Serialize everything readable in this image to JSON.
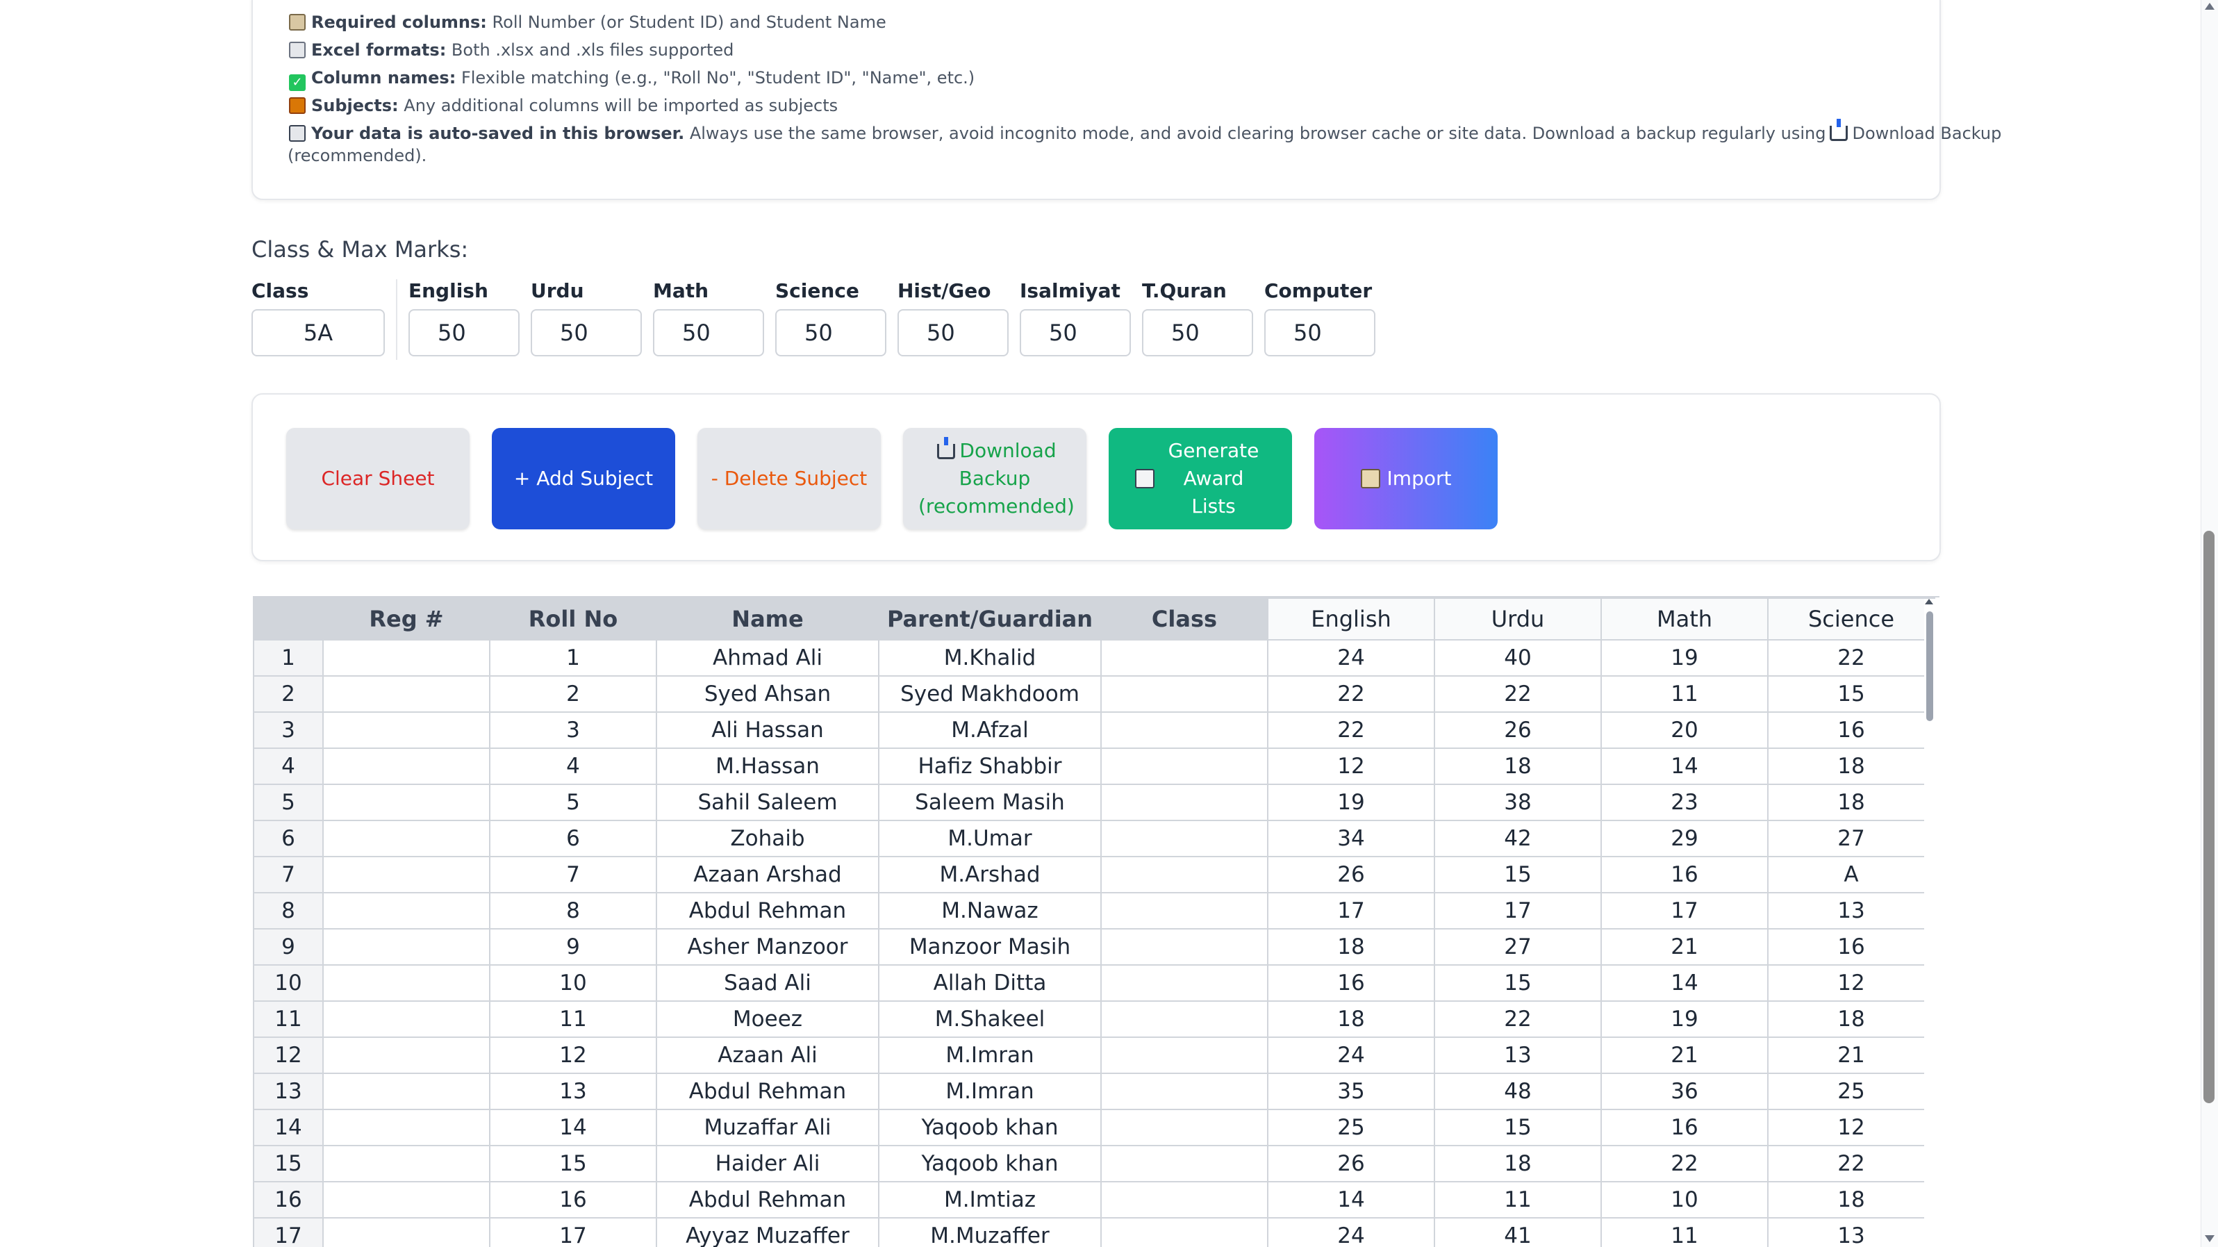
{
  "info": {
    "required_bold": "Required columns:",
    "required_text": " Roll Number (or Student ID) and Student Name",
    "excel_bold": "Excel formats:",
    "excel_text": " Both .xlsx and .xls files supported",
    "colnames_bold": "Column names:",
    "colnames_text": " Flexible matching (e.g., \"Roll No\", \"Student ID\", \"Name\", etc.)",
    "subjects_bold": "Subjects:",
    "subjects_text": " Any additional columns will be imported as subjects",
    "autosave_bold": "Your data is auto-saved in this browser.",
    "autosave_text": " Always use the same browser, avoid incognito mode, and avoid clearing browser cache or site data. Download a backup regularly using",
    "autosave_link": "Download Backup",
    "autosave_tail": "(recommended)."
  },
  "marks": {
    "title": "Class & Max Marks:",
    "class_label": "Class",
    "class_value": "5A",
    "subjects": [
      {
        "label": "English",
        "value": "50"
      },
      {
        "label": "Urdu",
        "value": "50"
      },
      {
        "label": "Math",
        "value": "50"
      },
      {
        "label": "Science",
        "value": "50"
      },
      {
        "label": "Hist/Geo",
        "value": "50"
      },
      {
        "label": "Isalmiyat",
        "value": "50"
      },
      {
        "label": "T.Quran",
        "value": "50"
      },
      {
        "label": "Computer",
        "value": "50"
      }
    ]
  },
  "buttons": {
    "clear": "Clear Sheet",
    "add": "+ Add Subject",
    "delete": "- Delete Subject",
    "download": "Download Backup (recommended)",
    "generate": "Generate Award Lists",
    "import": "Import"
  },
  "table": {
    "headers": [
      "",
      "Reg #",
      "Roll No",
      "Name",
      "Parent/Guardian",
      "Class",
      "English",
      "Urdu",
      "Math",
      "Science"
    ],
    "rows": [
      [
        "1",
        "",
        "1",
        "Ahmad Ali",
        "M.Khalid",
        "",
        "24",
        "40",
        "19",
        "22"
      ],
      [
        "2",
        "",
        "2",
        "Syed Ahsan",
        "Syed Makhdoom",
        "",
        "22",
        "22",
        "11",
        "15"
      ],
      [
        "3",
        "",
        "3",
        "Ali Hassan",
        "M.Afzal",
        "",
        "22",
        "26",
        "20",
        "16"
      ],
      [
        "4",
        "",
        "4",
        "M.Hassan",
        "Hafiz Shabbir",
        "",
        "12",
        "18",
        "14",
        "18"
      ],
      [
        "5",
        "",
        "5",
        "Sahil Saleem",
        "Saleem Masih",
        "",
        "19",
        "38",
        "23",
        "18"
      ],
      [
        "6",
        "",
        "6",
        "Zohaib",
        "M.Umar",
        "",
        "34",
        "42",
        "29",
        "27"
      ],
      [
        "7",
        "",
        "7",
        "Azaan Arshad",
        "M.Arshad",
        "",
        "26",
        "15",
        "16",
        "A"
      ],
      [
        "8",
        "",
        "8",
        "Abdul Rehman",
        "M.Nawaz",
        "",
        "17",
        "17",
        "17",
        "13"
      ],
      [
        "9",
        "",
        "9",
        "Asher Manzoor",
        "Manzoor Masih",
        "",
        "18",
        "27",
        "21",
        "16"
      ],
      [
        "10",
        "",
        "10",
        "Saad Ali",
        "Allah Ditta",
        "",
        "16",
        "15",
        "14",
        "12"
      ],
      [
        "11",
        "",
        "11",
        "Moeez",
        "M.Shakeel",
        "",
        "18",
        "22",
        "19",
        "18"
      ],
      [
        "12",
        "",
        "12",
        "Azaan Ali",
        "M.Imran",
        "",
        "24",
        "13",
        "21",
        "21"
      ],
      [
        "13",
        "",
        "13",
        "Abdul Rehman",
        "M.Imran",
        "",
        "35",
        "48",
        "36",
        "25"
      ],
      [
        "14",
        "",
        "14",
        "Muzaffar Ali",
        "Yaqoob khan",
        "",
        "25",
        "15",
        "16",
        "12"
      ],
      [
        "15",
        "",
        "15",
        "Haider Ali",
        "Yaqoob khan",
        "",
        "26",
        "18",
        "22",
        "22"
      ],
      [
        "16",
        "",
        "16",
        "Abdul Rehman",
        "M.Imtiaz",
        "",
        "14",
        "11",
        "10",
        "18"
      ],
      [
        "17",
        "",
        "17",
        "Ayyaz Muzaffer",
        "M.Muzaffer",
        "",
        "24",
        "41",
        "11",
        "13"
      ]
    ]
  }
}
